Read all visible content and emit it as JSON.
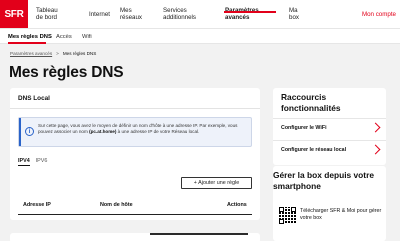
{
  "brand": {
    "logo_text": "SFR",
    "color": "#e2001a"
  },
  "topnav": {
    "items": [
      {
        "label": "Tableau de bord"
      },
      {
        "label": "Internet"
      },
      {
        "label": "Mes réseaux"
      },
      {
        "label": "Services additionnels"
      },
      {
        "label": "Paramètres avancés"
      },
      {
        "label": "Ma box"
      }
    ],
    "active": "Paramètres avancés",
    "account_label": "Mon compte"
  },
  "subnav": {
    "items": [
      {
        "label": "Mes règles DNS"
      },
      {
        "label": "Accès"
      },
      {
        "label": "Wifi"
      }
    ],
    "active": "Mes règles DNS"
  },
  "breadcrumb": {
    "parent": "Paramètres avancés",
    "separator": ">",
    "current": "Mes règles DNS"
  },
  "page_title": "Mes règles DNS",
  "dns_card": {
    "title": "DNS Local",
    "info_icon": "info-icon",
    "info_text_1": "Sur cette page, vous avez le moyen de définir un nom d'hôte à une adresse IP. Par exemple, vous pouvez associer un nom ",
    "info_bold": "(pc.at.home)",
    "info_text_2": " à une adresse IP de votre Réseau local.",
    "tabs": [
      {
        "label": "IPV4"
      },
      {
        "label": "IPV6"
      }
    ],
    "active_tab": "IPV4",
    "add_button": "+ Ajouter une règle",
    "columns": [
      "Adresse IP",
      "Nom de hôte",
      "Actions"
    ]
  },
  "shortcuts": {
    "title": "Raccourcis fonctionnalités",
    "links": [
      {
        "label": "Configurer le WiFi"
      },
      {
        "label": "Configurer le réseau local"
      }
    ],
    "chevron_icon": "chevron-right-icon"
  },
  "box_app": {
    "title": "Gérer la box depuis votre smartphone",
    "qr_icon": "qr-code-icon",
    "text": "Télécharger SFR & Moi pour gérer votre box"
  }
}
